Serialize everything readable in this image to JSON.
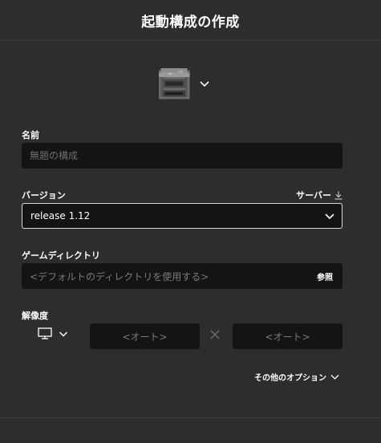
{
  "dialog": {
    "title": "起動構成の作成"
  },
  "icon_picker": {
    "icon": "furnace-block-icon"
  },
  "name_field": {
    "label": "名前",
    "value": "",
    "placeholder": "無題の構成"
  },
  "version": {
    "label": "バージョン",
    "server_link": "サーバー",
    "server_icon": "download-icon",
    "selected": "release 1.12"
  },
  "game_directory": {
    "label": "ゲームディレクトリ",
    "placeholder": "<デフォルトのディレクトリを使用する>",
    "browse_label": "参照"
  },
  "resolution": {
    "label": "解像度",
    "monitor_icon": "monitor-icon",
    "width_placeholder": "<オート>",
    "height_placeholder": "<オート>",
    "separator_icon": "times-icon"
  },
  "more_options": {
    "label": "その他のオプション"
  },
  "colors": {
    "background": "#2d2d2d",
    "field_background": "#141414",
    "placeholder_text": "#7a7a7a",
    "select_border": "#d8d8d8",
    "text": "#ffffff"
  }
}
